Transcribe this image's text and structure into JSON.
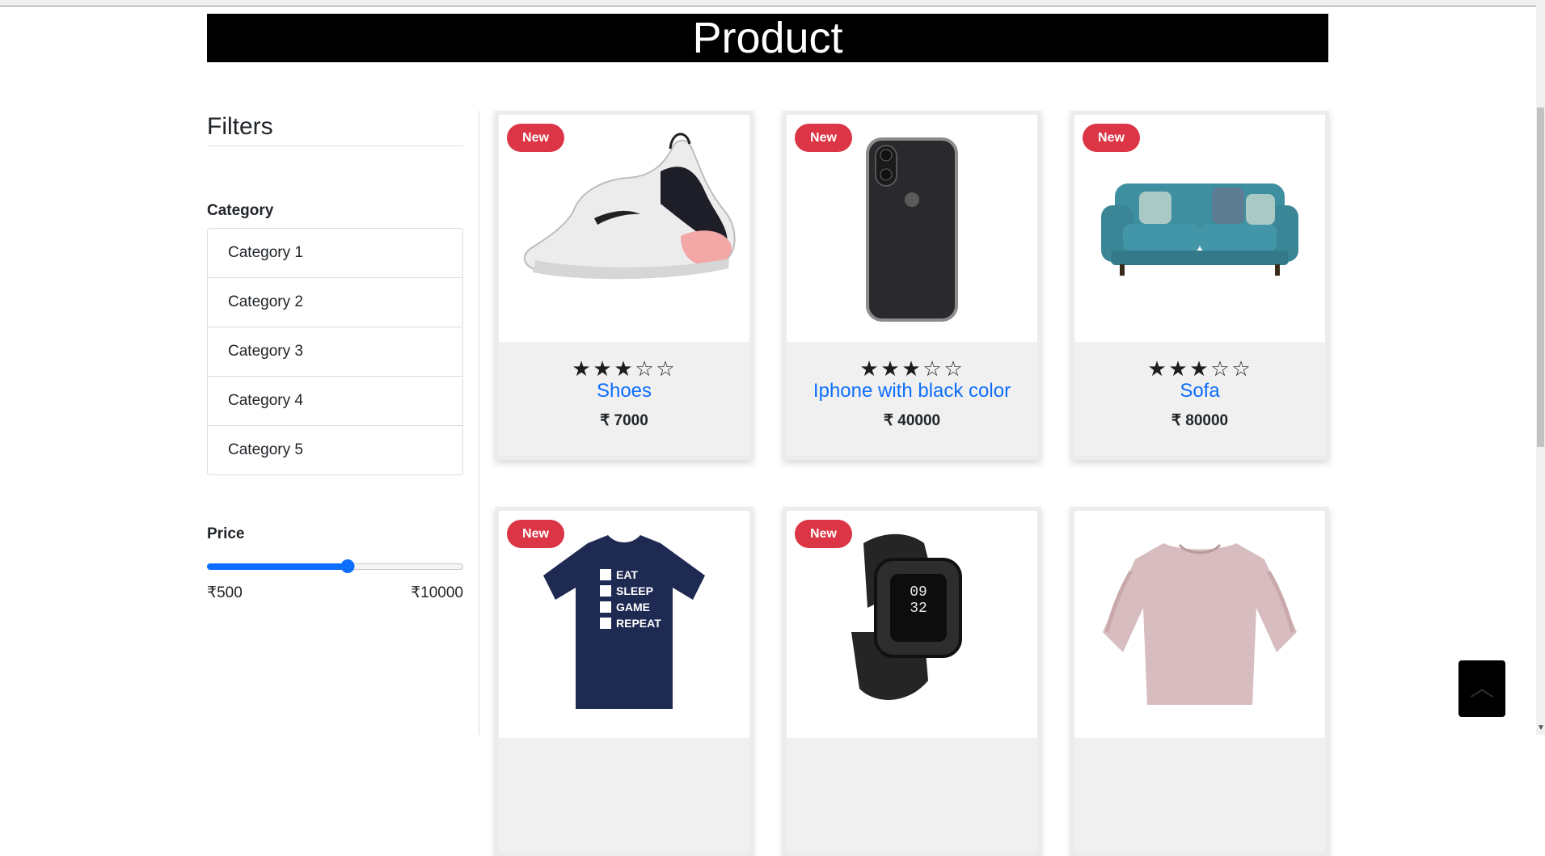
{
  "header": {
    "title": "Product"
  },
  "sidebar": {
    "title": "Filters",
    "category_label": "Category",
    "categories": [
      "Category 1",
      "Category 2",
      "Category 3",
      "Category 4",
      "Category 5"
    ],
    "price_label": "Price",
    "price_min": "₹500",
    "price_max": "₹10000",
    "slider_value_fraction": 0.55
  },
  "products": [
    {
      "title": "Shoes",
      "price": "₹ 7000",
      "badge": "New",
      "rating": 3,
      "rating_max": 5,
      "image": "sneaker-image"
    },
    {
      "title": "Iphone with black color",
      "price": "₹ 40000",
      "badge": "New",
      "rating": 3,
      "rating_max": 5,
      "image": "phone-image"
    },
    {
      "title": "Sofa",
      "price": "₹ 80000",
      "badge": "New",
      "rating": 3,
      "rating_max": 5,
      "image": "sofa-image"
    },
    {
      "title": "",
      "price": "",
      "badge": "New",
      "rating": null,
      "image": "tshirt-image",
      "image_text": [
        "EAT",
        "SLEEP",
        "GAME",
        "REPEAT"
      ]
    },
    {
      "title": "",
      "price": "",
      "badge": "New",
      "rating": null,
      "image": "smartwatch-image",
      "image_text": [
        "09",
        "32"
      ]
    },
    {
      "title": "",
      "price": "",
      "badge": "",
      "rating": null,
      "image": "blouse-image"
    }
  ],
  "colors": {
    "header_bg": "#000000",
    "badge": "#dc3545",
    "link": "#0d6efd",
    "card_bg": "#f0f0f0"
  },
  "icons": {
    "star_filled": "★",
    "star_empty": "☆",
    "back_to_top": "chevron-up-icon"
  }
}
